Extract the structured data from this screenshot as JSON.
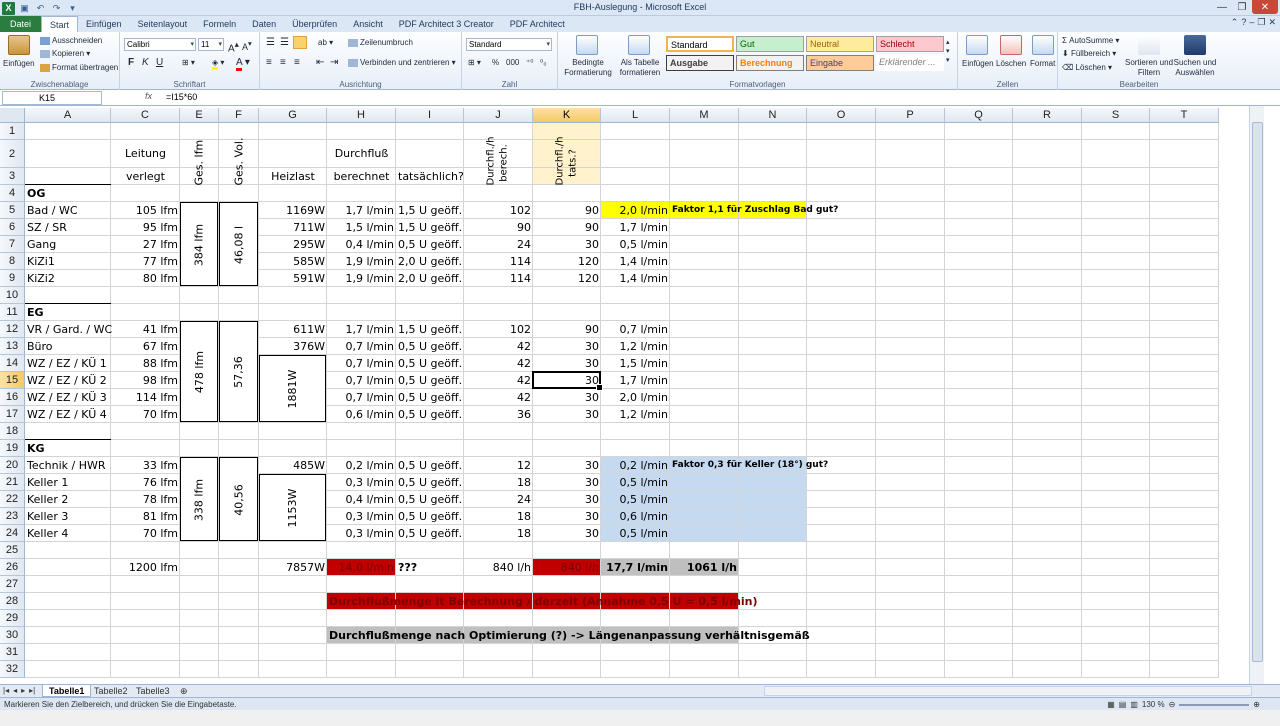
{
  "window": {
    "title": "FBH-Auslegung - Microsoft Excel"
  },
  "tabs": [
    "Datei",
    "Start",
    "Einfügen",
    "Seitenlayout",
    "Formeln",
    "Daten",
    "Überprüfen",
    "Ansicht",
    "PDF Architect 3 Creator",
    "PDF Architect"
  ],
  "ribbon": {
    "clipboard": {
      "paste": "Einfügen",
      "cut": "Ausschneiden",
      "copy": "Kopieren",
      "format": "Format übertragen",
      "label": "Zwischenablage"
    },
    "font": {
      "name": "Calibri",
      "size": "11",
      "label": "Schriftart"
    },
    "alignment": {
      "wrap": "Zeilenumbruch",
      "merge": "Verbinden und zentrieren",
      "label": "Ausrichtung"
    },
    "number": {
      "format": "Standard",
      "percent": "%",
      "thousands": "000",
      "label": "Zahl"
    },
    "styles": {
      "cond": "Bedingte Formatierung",
      "table": "Als Tabelle formatieren",
      "cells": [
        "Standard",
        "Gut",
        "Neutral",
        "Schlecht",
        "Ausgabe",
        "Berechnung",
        "Eingabe",
        "Erklärender ..."
      ],
      "label": "Formatvorlagen"
    },
    "cellsgroup": {
      "insert": "Einfügen",
      "delete": "Löschen",
      "format": "Format",
      "label": "Zellen"
    },
    "editing": {
      "autosum": "AutoSumme",
      "fill": "Füllbereich",
      "clear": "Löschen",
      "sort": "Sortieren und Filtern",
      "find": "Suchen und Auswählen",
      "label": "Bearbeiten"
    }
  },
  "formula": {
    "cell": "K15",
    "fx": "fx",
    "value": "=I15*60"
  },
  "columns": [
    "A",
    "C",
    "E",
    "F",
    "G",
    "H",
    "I",
    "J",
    "K",
    "L",
    "M",
    "N",
    "O",
    "P",
    "Q",
    "R",
    "S",
    "T"
  ],
  "rows": [
    "1",
    "2",
    "3",
    "4",
    "5",
    "6",
    "7",
    "8",
    "9",
    "10",
    "11",
    "12",
    "13",
    "14",
    "15",
    "16",
    "17",
    "18",
    "19",
    "20",
    "21",
    "22",
    "23",
    "24",
    "25",
    "26",
    "27",
    "28",
    "29",
    "30",
    "31",
    "32"
  ],
  "headers": {
    "leitung": "Leitung",
    "verlegt": "verlegt",
    "gesLfm": "Ges. lfm",
    "gesVol": "Ges. Vol.",
    "heizlast": "Heizlast",
    "durchfluss": "Durchfluß",
    "berechnet": "berechnet",
    "tatsaechlich": "tatsächlich?",
    "durchflBerech": "Durchfl./h berech.",
    "durchflTats": "Durchfl./h tats.?"
  },
  "sections": {
    "og": "OG",
    "eg": "EG",
    "kg": "KG"
  },
  "og": [
    {
      "a": "Bad / WC",
      "c": "105 lfm",
      "g": "1169W",
      "h": "1,7 l/min",
      "i": "1,5 U geöff.",
      "j": "102",
      "k": "90",
      "l": "2,0 l/min"
    },
    {
      "a": "SZ / SR",
      "c": "95 lfm",
      "g": "711W",
      "h": "1,5 l/min",
      "i": "1,5 U geöff.",
      "j": "90",
      "k": "90",
      "l": "1,7 l/min"
    },
    {
      "a": "Gang",
      "c": "27 lfm",
      "g": "295W",
      "h": "0,4 l/min",
      "i": "0,5 U geöff.",
      "j": "24",
      "k": "30",
      "l": "0,5 l/min"
    },
    {
      "a": "KiZi1",
      "c": "77 lfm",
      "g": "585W",
      "h": "1,9 l/min",
      "i": "2,0 U geöff.",
      "j": "114",
      "k": "120",
      "l": "1,4 l/min"
    },
    {
      "a": "KiZi2",
      "c": "80 lfm",
      "g": "591W",
      "h": "1,9 l/min",
      "i": "2,0 U geöff.",
      "j": "114",
      "k": "120",
      "l": "1,4 l/min"
    }
  ],
  "og_merged": {
    "lfm": "384 lfm",
    "vol": "46,08 l"
  },
  "og_note": "Faktor 1,1 für Zuschlag Bad gut?",
  "eg": [
    {
      "a": "VR / Gard. / WC",
      "c": "41 lfm",
      "g": "611W",
      "h": "1,7 l/min",
      "i": "1,5 U geöff.",
      "j": "102",
      "k": "90",
      "l": "0,7 l/min"
    },
    {
      "a": "Büro",
      "c": "67 lfm",
      "g": "376W",
      "h": "0,7 l/min",
      "i": "0,5 U geöff.",
      "j": "42",
      "k": "30",
      "l": "1,2 l/min"
    },
    {
      "a": "WZ / EZ / KÜ 1",
      "c": "88 lfm",
      "g": "",
      "h": "0,7 l/min",
      "i": "0,5 U geöff.",
      "j": "42",
      "k": "30",
      "l": "1,5 l/min"
    },
    {
      "a": "WZ / EZ / KÜ 2",
      "c": "98 lfm",
      "g": "",
      "h": "0,7 l/min",
      "i": "0,5 U geöff.",
      "j": "42",
      "k": "30",
      "l": "1,7 l/min"
    },
    {
      "a": "WZ / EZ / KÜ 3",
      "c": "114 lfm",
      "g": "",
      "h": "0,7 l/min",
      "i": "0,5 U geöff.",
      "j": "42",
      "k": "30",
      "l": "2,0 l/min"
    },
    {
      "a": "WZ / EZ / KÜ 4",
      "c": "70 lfm",
      "g": "",
      "h": "0,6 l/min",
      "i": "0,5 U geöff.",
      "j": "36",
      "k": "30",
      "l": "1,2 l/min"
    }
  ],
  "eg_merged": {
    "lfm": "478 lfm",
    "vol": "57,36",
    "heiz": "1881W"
  },
  "kg": [
    {
      "a": "Technik / HWR",
      "c": "33 lfm",
      "g": "485W",
      "h": "0,2 l/min",
      "i": "0,5 U geöff.",
      "j": "12",
      "k": "30",
      "l": "0,2 l/min"
    },
    {
      "a": "Keller 1",
      "c": "76 lfm",
      "g": "",
      "h": "0,3 l/min",
      "i": "0,5 U geöff.",
      "j": "18",
      "k": "30",
      "l": "0,5 l/min"
    },
    {
      "a": "Keller 2",
      "c": "78 lfm",
      "g": "",
      "h": "0,4 l/min",
      "i": "0,5 U geöff.",
      "j": "24",
      "k": "30",
      "l": "0,5 l/min"
    },
    {
      "a": "Keller 3",
      "c": "81 lfm",
      "g": "",
      "h": "0,3 l/min",
      "i": "0,5 U geöff.",
      "j": "18",
      "k": "30",
      "l": "0,6 l/min"
    },
    {
      "a": "Keller 4",
      "c": "70 lfm",
      "g": "",
      "h": "0,3 l/min",
      "i": "0,5 U geöff.",
      "j": "18",
      "k": "30",
      "l": "0,5 l/min"
    }
  ],
  "kg_merged": {
    "lfm": "338 lfm",
    "vol": "40,56",
    "heiz": "1153W"
  },
  "kg_note": "Faktor 0,3 für Keller (18°) gut?",
  "totals": {
    "c": "1200 lfm",
    "g": "7857W",
    "h": "14,0 l/min",
    "i": "???",
    "j": "840 l/h",
    "k": "840 l/h",
    "l": "17,7 l/min",
    "m": "1061 l/h"
  },
  "notes": {
    "r28": "Durchflußmenge lt Berechnung / derzeit (Annahme 0,5 U = 0,5 l/min)",
    "r30": "Durchflußmenge nach Optimierung (?) -> Längenanpassung verhältnisgemäß"
  },
  "sheets": [
    "Tabelle1",
    "Tabelle2",
    "Tabelle3"
  ],
  "status": {
    "msg": "Markieren Sie den Zielbereich, und drücken Sie die Eingabetaste.",
    "zoom": "130 %"
  },
  "colors": {
    "yellow": "#ffff00",
    "blue": "#c5d9f1",
    "red": "#c00000",
    "gray": "#bfbfbf"
  }
}
